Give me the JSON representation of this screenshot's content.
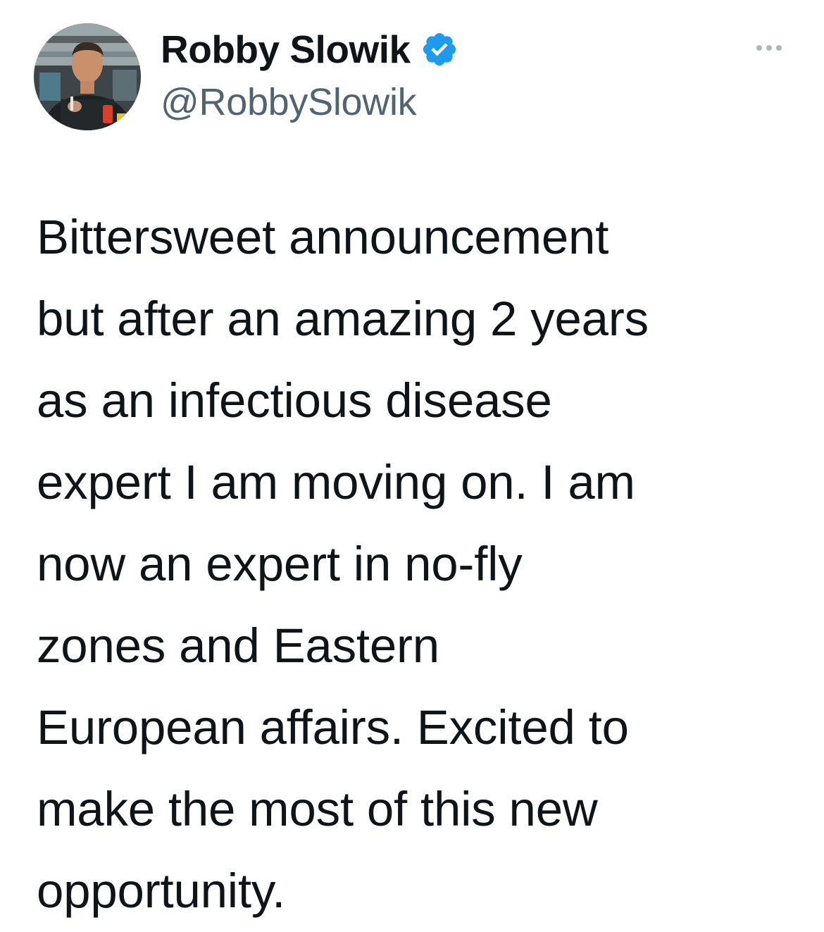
{
  "author": {
    "display_name": "Robby Slowik",
    "handle": "@RobbySlowik",
    "verified": true
  },
  "icons": {
    "avatar": "profile-photo",
    "verified": "verified-badge-icon",
    "more": "more-options-icon"
  },
  "colors": {
    "verified_blue": "#1d9bf0",
    "handle_gray": "#536471",
    "text": "#0f1419",
    "more_gray": "#aab8c2"
  },
  "tweet": {
    "lines": [
      "Bittersweet announcement",
      "but after an amazing 2 years",
      "as an infectious disease",
      "expert I am moving on. I am",
      "now an expert in no-fly",
      "zones and Eastern",
      "European affairs. Excited to",
      "make the most of this new",
      "opportunity."
    ]
  }
}
